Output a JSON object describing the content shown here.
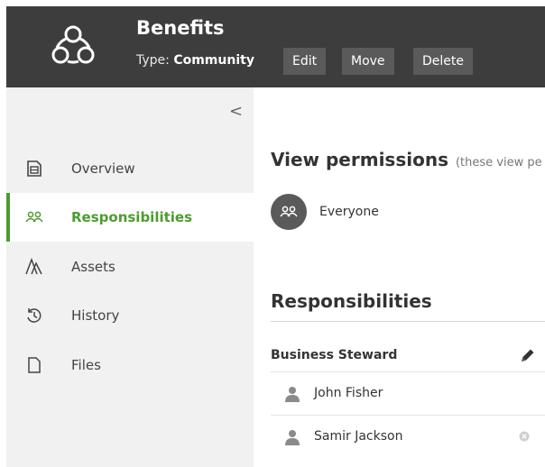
{
  "header": {
    "title": "Benefits",
    "type_label": "Type:",
    "type_value": "Community",
    "buttons": {
      "edit": "Edit",
      "move": "Move",
      "delete": "Delete"
    },
    "logo_icon": "community-icon"
  },
  "sidebar": {
    "collapse_glyph": "<",
    "items": [
      {
        "label": "Overview",
        "icon": "overview-icon",
        "active": false
      },
      {
        "label": "Responsibilities",
        "icon": "users-icon",
        "active": true
      },
      {
        "label": "Assets",
        "icon": "assets-icon",
        "active": false
      },
      {
        "label": "History",
        "icon": "history-icon",
        "active": false
      },
      {
        "label": "Files",
        "icon": "file-icon",
        "active": false
      }
    ]
  },
  "main": {
    "view_permissions": {
      "title": "View permissions",
      "subtitle": "(these view pe",
      "everyone_label": "Everyone"
    },
    "responsibilities": {
      "title": "Responsibilities",
      "role": "Business Steward",
      "people": [
        "John Fisher",
        "Samir Jackson"
      ]
    }
  },
  "colors": {
    "header_bg": "#3d3d3d",
    "button_bg": "#5a5a5a",
    "sidebar_bg": "#f1f1f1",
    "accent": "#4a9d2e"
  }
}
